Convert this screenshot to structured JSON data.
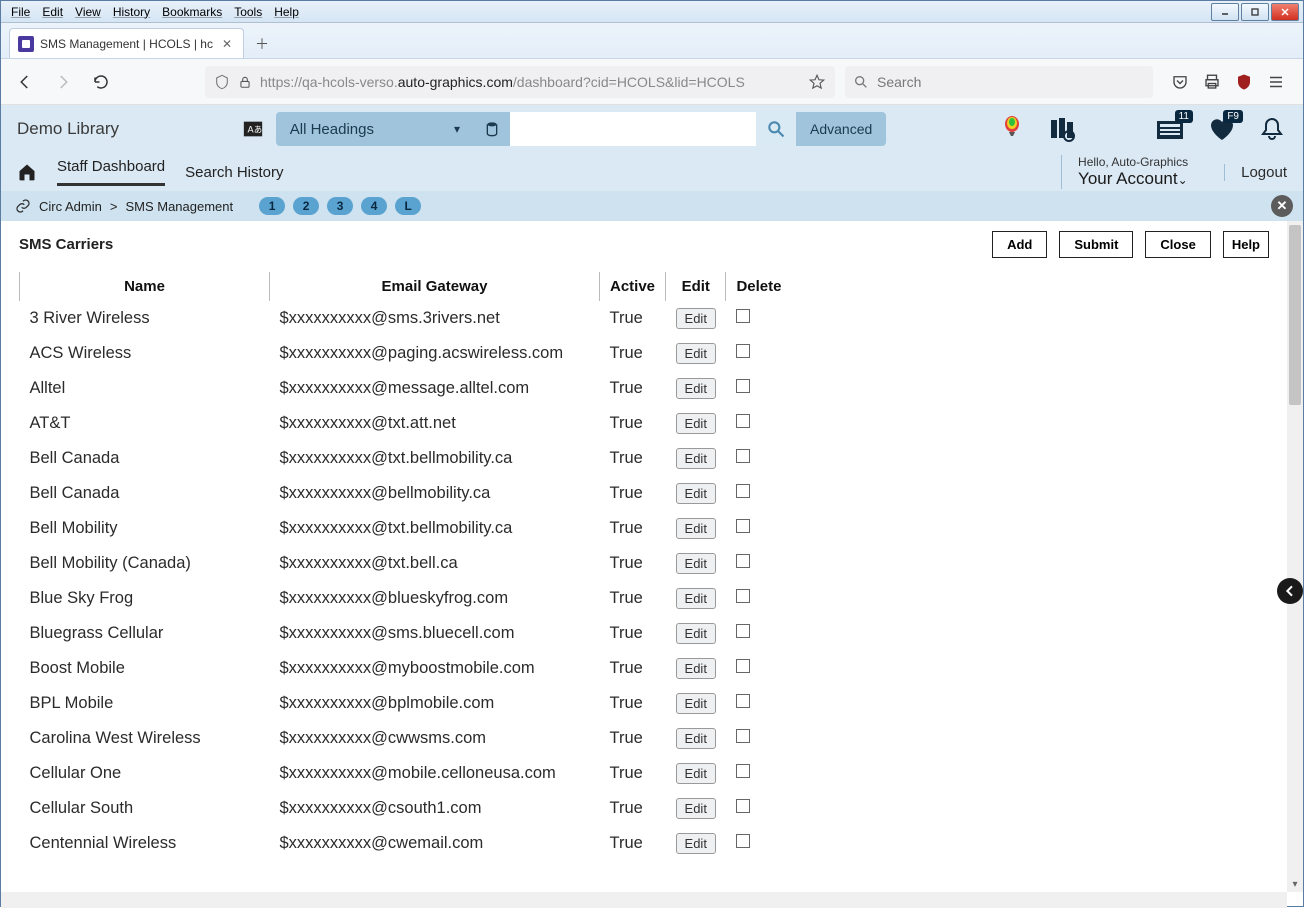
{
  "window": {
    "menus": [
      "File",
      "Edit",
      "View",
      "History",
      "Bookmarks",
      "Tools",
      "Help"
    ]
  },
  "tab": {
    "title": "SMS Management | HCOLS | hc"
  },
  "url": {
    "prefix": "https://qa-hcols-verso.",
    "host": "auto-graphics.com",
    "path": "/dashboard?cid=HCOLS&lid=HCOLS"
  },
  "browser_search_placeholder": "Search",
  "app": {
    "brand": "Demo Library",
    "dropdown": "All Headings",
    "advanced": "Advanced",
    "badge_news": "11",
    "badge_fav": "F9"
  },
  "nav": {
    "staff": "Staff Dashboard",
    "history": "Search History",
    "greeting": "Hello, Auto-Graphics",
    "account": "Your Account",
    "logout": "Logout"
  },
  "crumb": {
    "a": "Circ Admin",
    "sep": ">",
    "b": "SMS Management",
    "pills": [
      "1",
      "2",
      "3",
      "4",
      "L"
    ]
  },
  "panel": {
    "title": "SMS Carriers",
    "add": "Add",
    "submit": "Submit",
    "close": "Close",
    "help": "Help"
  },
  "cols": {
    "name": "Name",
    "gateway": "Email Gateway",
    "active": "Active",
    "edit": "Edit",
    "delete": "Delete"
  },
  "edit_label": "Edit",
  "rows": [
    {
      "name": "3 River Wireless",
      "gw": "$xxxxxxxxxx@sms.3rivers.net",
      "active": "True"
    },
    {
      "name": "ACS Wireless",
      "gw": "$xxxxxxxxxx@paging.acswireless.com",
      "active": "True"
    },
    {
      "name": "Alltel",
      "gw": "$xxxxxxxxxx@message.alltel.com",
      "active": "True"
    },
    {
      "name": "AT&T",
      "gw": "$xxxxxxxxxx@txt.att.net",
      "active": "True"
    },
    {
      "name": "Bell Canada",
      "gw": "$xxxxxxxxxx@txt.bellmobility.ca",
      "active": "True"
    },
    {
      "name": "Bell Canada",
      "gw": "$xxxxxxxxxx@bellmobility.ca",
      "active": "True"
    },
    {
      "name": "Bell Mobility",
      "gw": "$xxxxxxxxxx@txt.bellmobility.ca",
      "active": "True"
    },
    {
      "name": "Bell Mobility (Canada)",
      "gw": "$xxxxxxxxxx@txt.bell.ca",
      "active": "True"
    },
    {
      "name": "Blue Sky Frog",
      "gw": "$xxxxxxxxxx@blueskyfrog.com",
      "active": "True"
    },
    {
      "name": "Bluegrass Cellular",
      "gw": "$xxxxxxxxxx@sms.bluecell.com",
      "active": "True"
    },
    {
      "name": "Boost Mobile",
      "gw": "$xxxxxxxxxx@myboostmobile.com",
      "active": "True"
    },
    {
      "name": "BPL Mobile",
      "gw": "$xxxxxxxxxx@bplmobile.com",
      "active": "True"
    },
    {
      "name": "Carolina West Wireless",
      "gw": "$xxxxxxxxxx@cwwsms.com",
      "active": "True"
    },
    {
      "name": "Cellular One",
      "gw": "$xxxxxxxxxx@mobile.celloneusa.com",
      "active": "True"
    },
    {
      "name": "Cellular South",
      "gw": "$xxxxxxxxxx@csouth1.com",
      "active": "True"
    },
    {
      "name": "Centennial Wireless",
      "gw": "$xxxxxxxxxx@cwemail.com",
      "active": "True"
    }
  ]
}
